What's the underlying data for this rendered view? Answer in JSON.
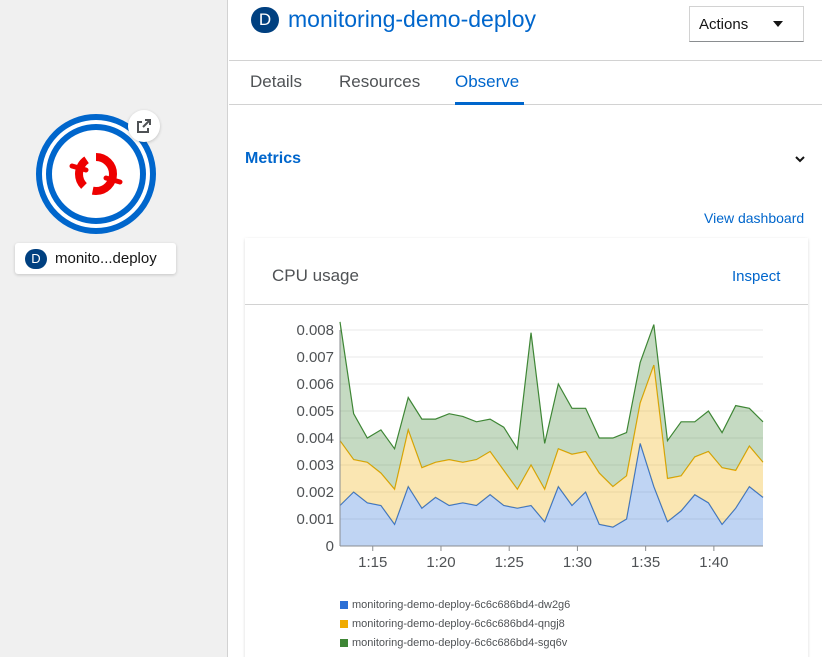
{
  "topology": {
    "node_badge": "D",
    "node_label": "monito...deploy"
  },
  "header": {
    "badge": "D",
    "title": "monitoring-demo-deploy",
    "actions_label": "Actions"
  },
  "tabs": [
    {
      "label": "Details",
      "active": false
    },
    {
      "label": "Resources",
      "active": false
    },
    {
      "label": "Observe",
      "active": true
    }
  ],
  "metrics": {
    "section_title": "Metrics",
    "view_dashboard": "View dashboard",
    "card_title": "CPU usage",
    "inspect_label": "Inspect"
  },
  "colors": {
    "accent": "#0066cc",
    "series_blue": "#2b6fd6",
    "series_yellow": "#f0ab00",
    "series_green": "#3e8635"
  },
  "chart_data": {
    "type": "area",
    "stacked": true,
    "x_start_minutes": 72.6,
    "x_tick_labels": [
      "1:15",
      "1:20",
      "1:25",
      "1:30",
      "1:35",
      "1:40"
    ],
    "x_tick_minutes": [
      75,
      80,
      85,
      90,
      95,
      100
    ],
    "ylim": [
      0,
      0.008
    ],
    "y_ticks": [
      "0",
      "0.001",
      "0.002",
      "0.003",
      "0.004",
      "0.005",
      "0.006",
      "0.007",
      "0.008"
    ],
    "series": [
      {
        "name": "monitoring-demo-deploy-6c6c686bd4-dw2g6",
        "color": "#2b6fd6",
        "values": [
          0.0015,
          0.002,
          0.0016,
          0.0015,
          0.0008,
          0.0022,
          0.0014,
          0.0018,
          0.0015,
          0.0016,
          0.0015,
          0.0019,
          0.0015,
          0.0014,
          0.0015,
          0.0009,
          0.0022,
          0.0015,
          0.002,
          0.0008,
          0.0007,
          0.001,
          0.0038,
          0.0022,
          0.0009,
          0.0013,
          0.0019,
          0.0016,
          0.0008,
          0.0014,
          0.0022,
          0.0018
        ]
      },
      {
        "name": "monitoring-demo-deploy-6c6c686bd4-qngj8",
        "color": "#f0ab00",
        "values": [
          0.0024,
          0.0012,
          0.0015,
          0.0012,
          0.0013,
          0.0021,
          0.0015,
          0.0013,
          0.0017,
          0.0015,
          0.0017,
          0.0016,
          0.0013,
          0.0007,
          0.0015,
          0.0012,
          0.0014,
          0.0019,
          0.0015,
          0.0019,
          0.0015,
          0.0016,
          0.0015,
          0.0045,
          0.0016,
          0.0013,
          0.0014,
          0.0019,
          0.0021,
          0.0014,
          0.0015,
          0.0013
        ]
      },
      {
        "name": "monitoring-demo-deploy-6c6c686bd4-sgq6v",
        "color": "#3e8635",
        "values": [
          0.0044,
          0.0017,
          0.0009,
          0.0016,
          0.0015,
          0.0012,
          0.0018,
          0.0016,
          0.0017,
          0.0017,
          0.0014,
          0.0012,
          0.0016,
          0.0015,
          0.0049,
          0.0017,
          0.0024,
          0.0017,
          0.0016,
          0.0013,
          0.0018,
          0.0016,
          0.0015,
          0.0015,
          0.0014,
          0.002,
          0.0013,
          0.0015,
          0.0013,
          0.0024,
          0.0014,
          0.0015
        ]
      }
    ]
  }
}
